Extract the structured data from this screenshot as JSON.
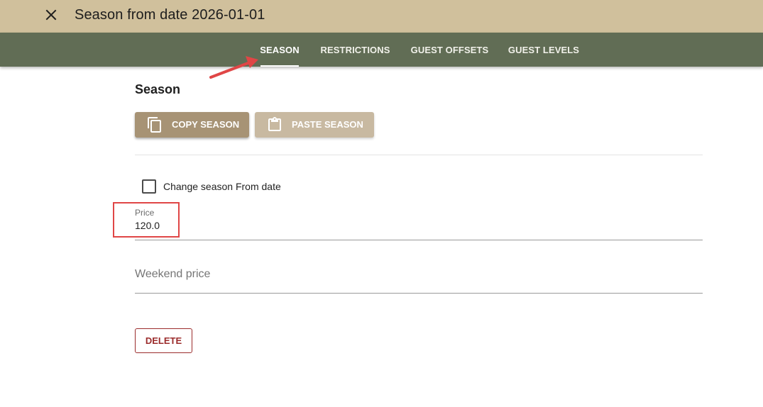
{
  "dialog": {
    "title": "Season from date 2026-01-01"
  },
  "tabs": [
    {
      "label": "SEASON",
      "active": true
    },
    {
      "label": "RESTRICTIONS",
      "active": false
    },
    {
      "label": "GUEST OFFSETS",
      "active": false
    },
    {
      "label": "GUEST LEVELS",
      "active": false
    }
  ],
  "section": {
    "title": "Season"
  },
  "toolbar": {
    "copy_label": "COPY SEASON",
    "copy_icon": "copy-icon",
    "paste_label": "PASTE SEASON",
    "paste_icon": "clipboard-icon"
  },
  "form": {
    "change_from_date_label": "Change season From date",
    "change_from_date_checked": false,
    "price_label": "Price",
    "price_value": "120.0",
    "weekend_price_placeholder": "Weekend price",
    "delete_label": "DELETE"
  },
  "colors": {
    "title_bar": "#d0c09c",
    "tab_bar": "#616d55",
    "primary_button": "#a79375",
    "disabled_button": "#c8b9a1",
    "delete_accent": "#9b2c2c",
    "annotation": "#e04646"
  }
}
